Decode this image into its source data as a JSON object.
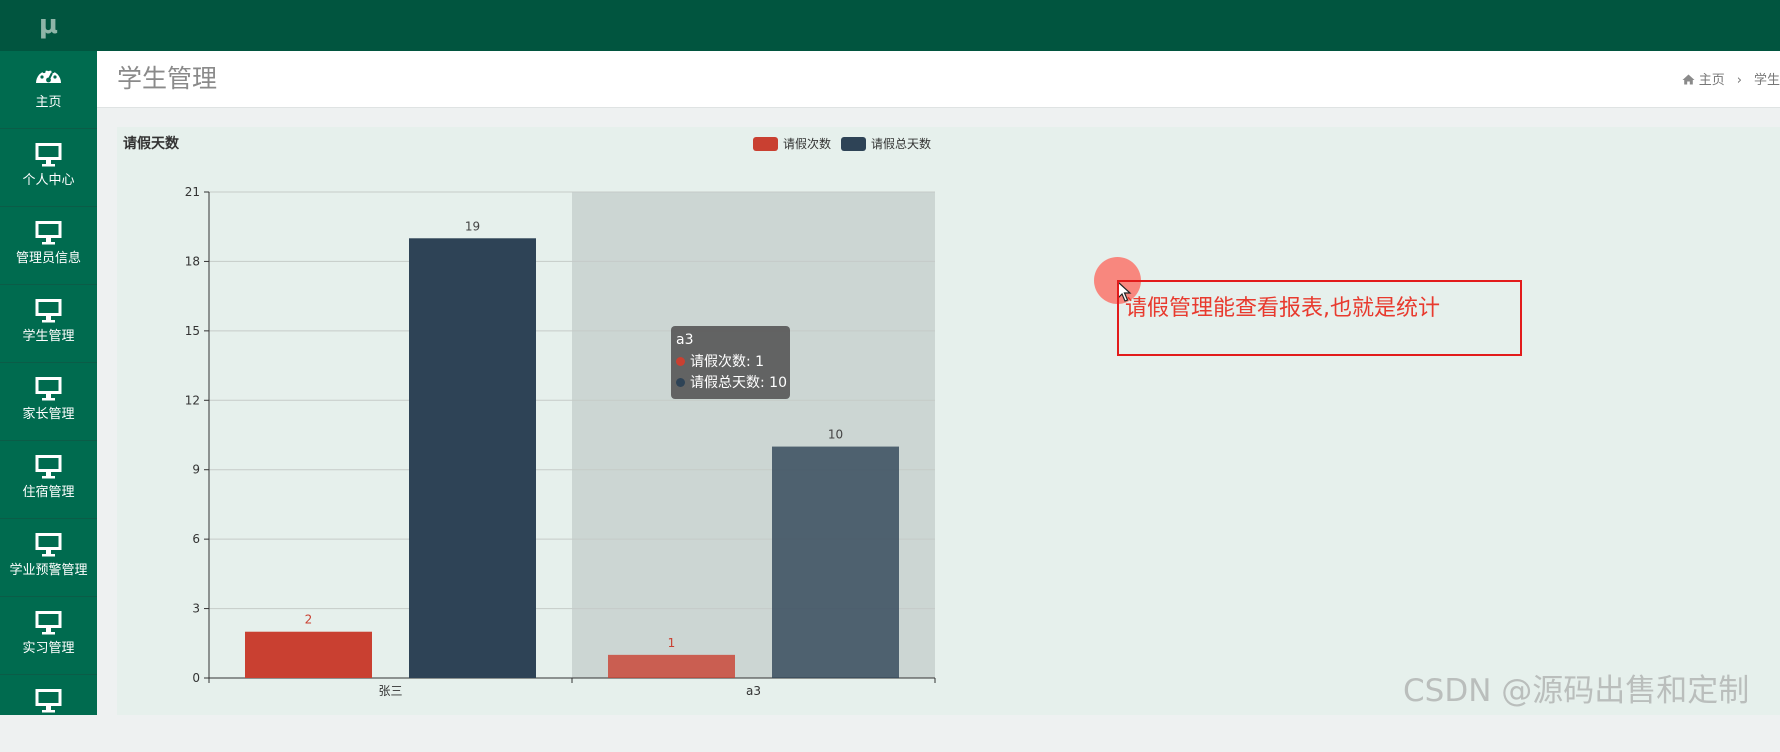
{
  "sidebar": {
    "logo": "μ",
    "items": [
      {
        "label": "主页",
        "icon": "dashboard-icon"
      },
      {
        "label": "个人中心",
        "icon": "monitor-icon"
      },
      {
        "label": "管理员信息",
        "icon": "monitor-icon"
      },
      {
        "label": "学生管理",
        "icon": "monitor-icon"
      },
      {
        "label": "家长管理",
        "icon": "monitor-icon"
      },
      {
        "label": "住宿管理",
        "icon": "monitor-icon"
      },
      {
        "label": "学业预警管理",
        "icon": "monitor-icon"
      },
      {
        "label": "实习管理",
        "icon": "monitor-icon"
      },
      {
        "label": "",
        "icon": "monitor-icon"
      }
    ]
  },
  "header": {
    "title": "学生管理",
    "breadcrumb": {
      "home": "主页",
      "separator": "›",
      "current": "学生"
    }
  },
  "colors": {
    "accent": "#006b4f",
    "topbar": "#01553f",
    "series1": "#c94031",
    "series2": "#2e4356"
  },
  "chart_data": {
    "type": "bar",
    "title": "请假天数",
    "categories": [
      "张三",
      "a3"
    ],
    "series": [
      {
        "name": "请假次数",
        "values": [
          2,
          1
        ],
        "color": "#c94031"
      },
      {
        "name": "请假总天数",
        "values": [
          19,
          10
        ],
        "color": "#2e4356"
      }
    ],
    "ylim": [
      0,
      21
    ],
    "yticks": [
      0,
      3,
      6,
      9,
      12,
      15,
      18,
      21
    ],
    "grid": true,
    "legend": "top-center",
    "highlighted_category": "a3"
  },
  "tooltip": {
    "title": "a3",
    "rows": [
      {
        "label": "请假次数: 1",
        "color": "#c94031"
      },
      {
        "label": "请假总天数: 10",
        "color": "#2e4356"
      }
    ]
  },
  "annotation": {
    "text": "请假管理能查看报表,也就是统计"
  },
  "watermark": "CSDN @源码出售和定制"
}
